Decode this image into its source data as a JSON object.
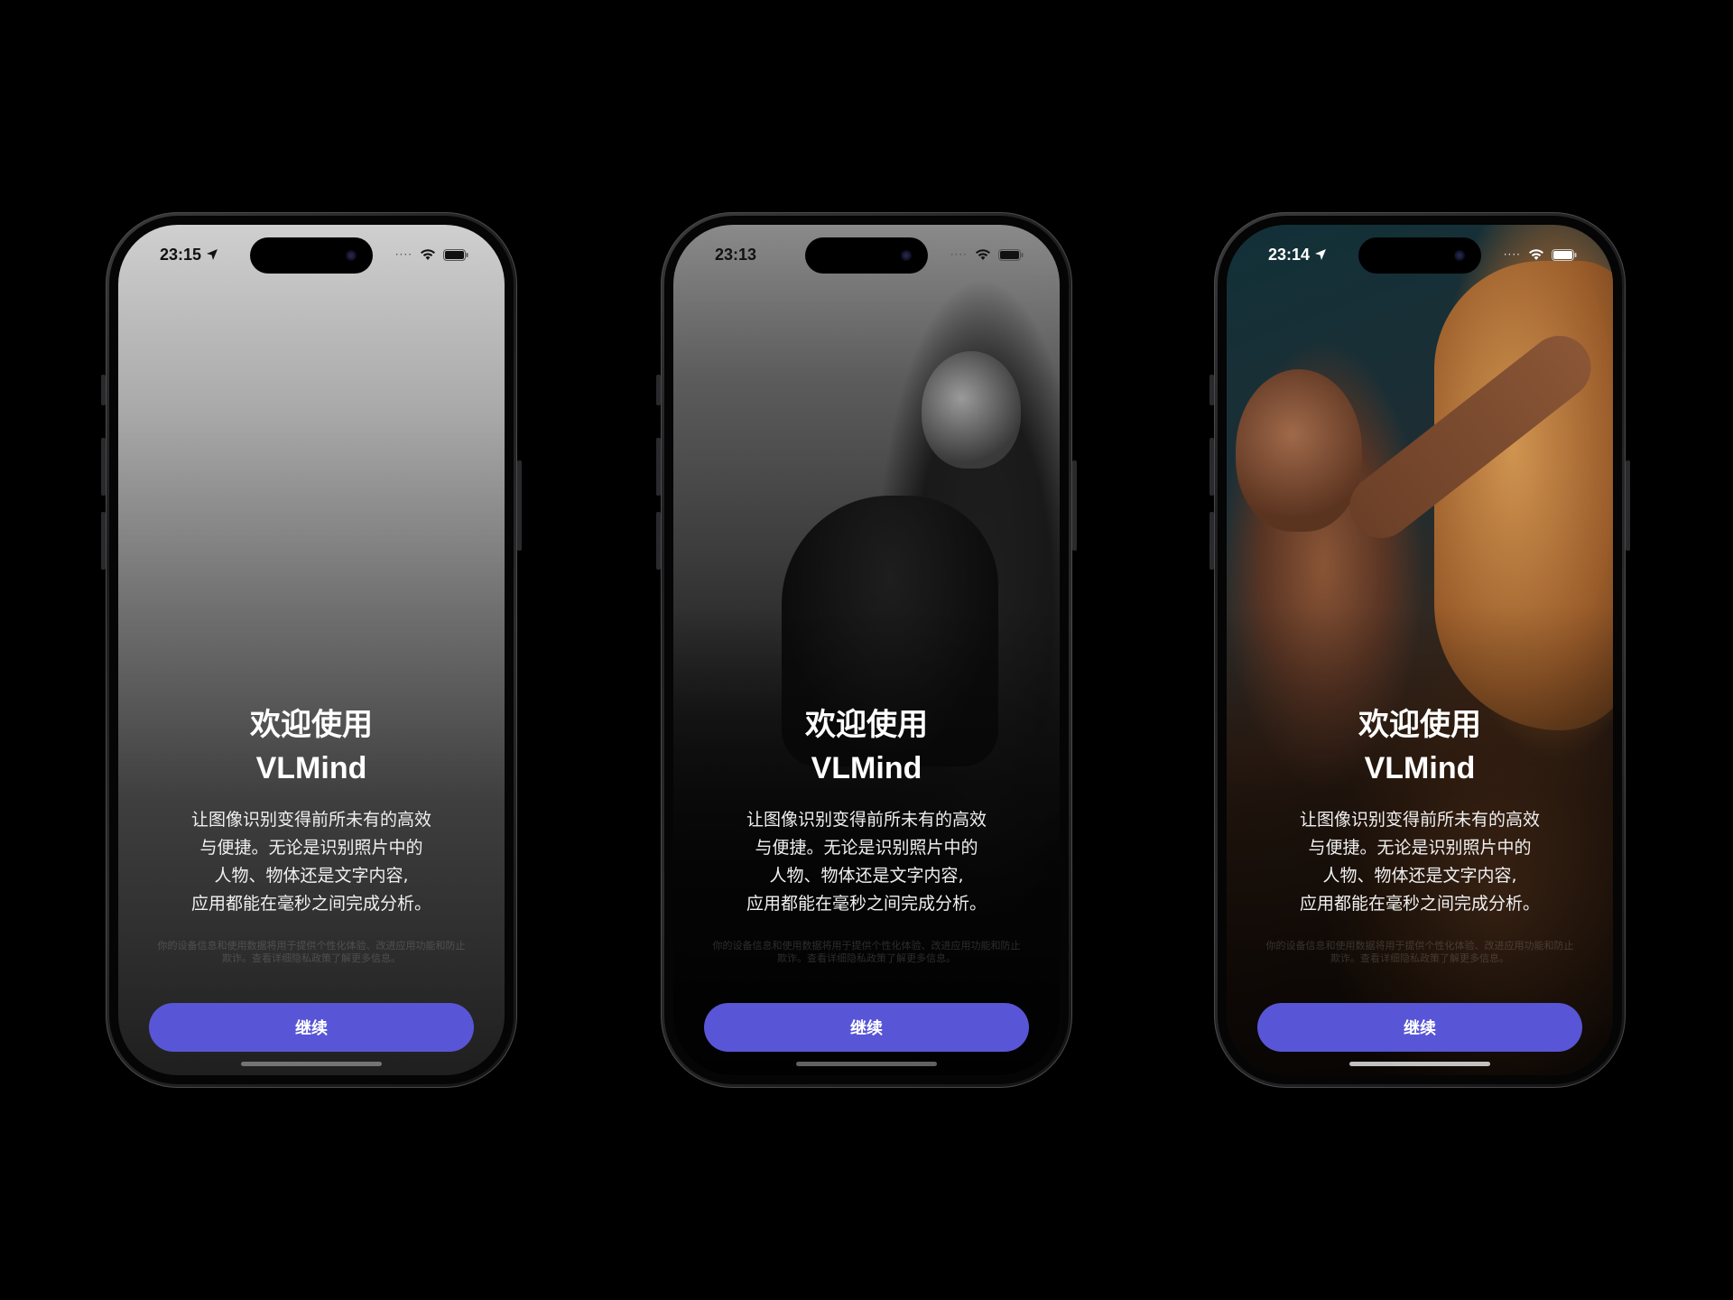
{
  "phones": [
    {
      "time": "23:15",
      "title_line1": "欢迎使用",
      "title_line2": "VLMind",
      "desc": [
        "让图像识别变得前所未有的高效",
        "与便捷。无论是识别照片中的",
        "人物、物体还是文字内容,",
        "应用都能在毫秒之间完成分析。"
      ],
      "privacy": [
        "你的设备信息和使用数据将用于提供个性化体验、改进应用功能和防止",
        "欺诈。查看详细隐私政策了解更多信息。"
      ],
      "button_label": "继续"
    },
    {
      "time": "23:13",
      "title_line1": "欢迎使用",
      "title_line2": "VLMind",
      "desc": [
        "让图像识别变得前所未有的高效",
        "与便捷。无论是识别照片中的",
        "人物、物体还是文字内容,",
        "应用都能在毫秒之间完成分析。"
      ],
      "privacy": [
        "你的设备信息和使用数据将用于提供个性化体验、改进应用功能和防止",
        "欺诈。查看详细隐私政策了解更多信息。"
      ],
      "button_label": "继续"
    },
    {
      "time": "23:14",
      "title_line1": "欢迎使用",
      "title_line2": "VLMind",
      "desc": [
        "让图像识别变得前所未有的高效",
        "与便捷。无论是识别照片中的",
        "人物、物体还是文字内容,",
        "应用都能在毫秒之间完成分析。"
      ],
      "privacy": [
        "你的设备信息和使用数据将用于提供个性化体验、改进应用功能和防止",
        "欺诈。查看详细隐私政策了解更多信息。"
      ],
      "button_label": "继续"
    }
  ],
  "colors": {
    "accent": "#5856d6",
    "background": "#000000"
  },
  "icons": {
    "location": "location-arrow-icon",
    "wifi": "wifi-icon",
    "battery": "battery-icon"
  }
}
